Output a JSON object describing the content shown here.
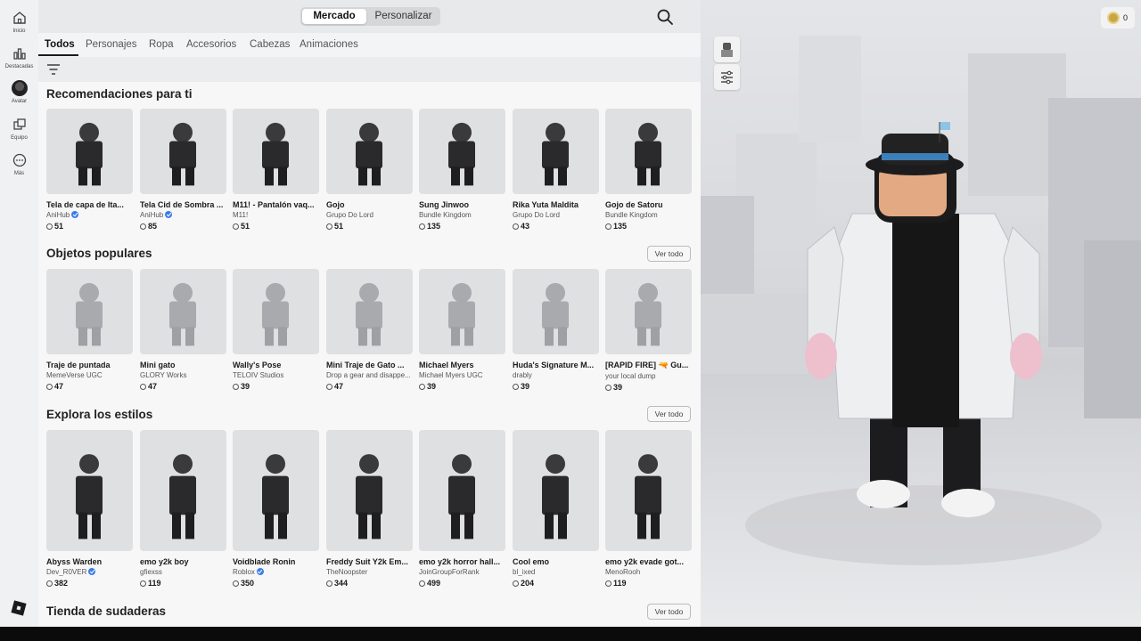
{
  "nav": [
    {
      "label": "Inicio",
      "icon": "home-icon"
    },
    {
      "label": "Destacadas",
      "icon": "chart-icon"
    },
    {
      "label": "Avatar",
      "icon": "avatar-icon"
    },
    {
      "label": "Equipo",
      "icon": "inventory-icon"
    },
    {
      "label": "Más",
      "icon": "more-icon"
    }
  ],
  "topbar": {
    "tab_market": "Mercado",
    "tab_customize": "Personalizar"
  },
  "tabs": [
    "Todos",
    "Personajes",
    "Ropa",
    "Accesorios",
    "Cabezas",
    "Animaciones"
  ],
  "sections": [
    {
      "title": "Recomendaciones para ti",
      "ver_todo": "",
      "items": [
        {
          "name": "Tela de capa de Ita...",
          "creator": "AniHub",
          "verified": true,
          "price": "51"
        },
        {
          "name": "Tela Cid de Sombra ...",
          "creator": "AniHub",
          "verified": true,
          "price": "85"
        },
        {
          "name": "M11! - Pantalón vaq...",
          "creator": "M11!",
          "verified": false,
          "price": "51"
        },
        {
          "name": "Gojo",
          "creator": "Grupo Do Lord",
          "verified": false,
          "price": "51"
        },
        {
          "name": "Sung Jinwoo",
          "creator": "Bundle Kingdom",
          "verified": false,
          "price": "135"
        },
        {
          "name": "Rika Yuta Maldita",
          "creator": "Grupo Do Lord",
          "verified": false,
          "price": "43"
        },
        {
          "name": "Gojo de Satoru",
          "creator": "Bundle Kingdom",
          "verified": false,
          "price": "135"
        }
      ]
    },
    {
      "title": "Objetos populares",
      "ver_todo": "Ver todo",
      "items": [
        {
          "name": "Traje de puntada",
          "creator": "MemeVerse UGC",
          "verified": false,
          "price": "47"
        },
        {
          "name": "Mini gato",
          "creator": "GLORY Works",
          "verified": false,
          "price": "47"
        },
        {
          "name": "Wally's Pose",
          "creator": "TELOIV Studios",
          "verified": false,
          "price": "39"
        },
        {
          "name": "Mini Traje de Gato ...",
          "creator": "Drop a gear and disappe...",
          "verified": false,
          "price": "47"
        },
        {
          "name": "Michael Myers",
          "creator": "Michael Myers UGC",
          "verified": false,
          "price": "39"
        },
        {
          "name": "Huda's Signature M...",
          "creator": "drably",
          "verified": false,
          "price": "39"
        },
        {
          "name": "[RAPID FIRE] 🔫 Gu...",
          "creator": "your local dump",
          "verified": false,
          "price": "39"
        }
      ]
    },
    {
      "title": "Explora los estilos",
      "ver_todo": "Ver todo",
      "items": [
        {
          "name": "Abyss Warden",
          "creator": "Dev_R0VER",
          "verified": true,
          "price": "382"
        },
        {
          "name": "emo y2k boy",
          "creator": "gfiexss",
          "verified": false,
          "price": "119"
        },
        {
          "name": "Voidblade Ronin",
          "creator": "Roblox",
          "verified": true,
          "price": "350"
        },
        {
          "name": "Freddy Suit Y2k Em...",
          "creator": "TheNoopster",
          "verified": false,
          "price": "344"
        },
        {
          "name": "emo y2k horror hall...",
          "creator": "JoinGroupForRank",
          "verified": false,
          "price": "499"
        },
        {
          "name": "Cool emo",
          "creator": "bl_ixed",
          "verified": false,
          "price": "204"
        },
        {
          "name": "emo y2k evade got...",
          "creator": "MenoRooh",
          "verified": false,
          "price": "119"
        }
      ]
    },
    {
      "title": "Tienda de sudaderas",
      "ver_todo": "Ver todo",
      "items": []
    }
  ],
  "preview": {
    "robux_balance": "0"
  },
  "colors": {
    "accent_dark": "#1a1a1a",
    "verified_blue": "#3b7de8",
    "robux_gold": "#c7a742"
  }
}
